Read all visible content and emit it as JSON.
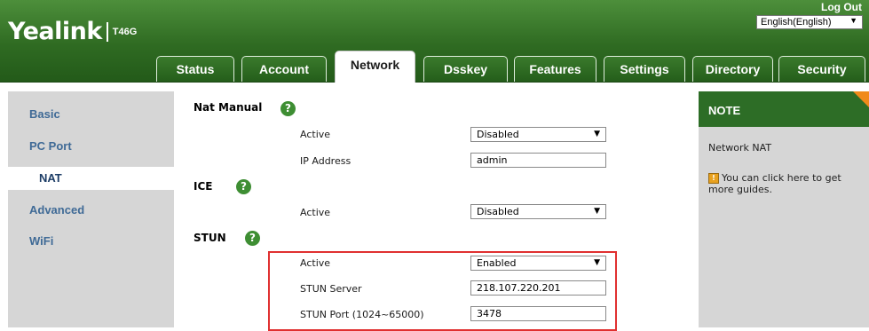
{
  "header": {
    "brand": "Yealink",
    "model": "T46G",
    "logout": "Log Out",
    "language": "English(English)"
  },
  "tabs": [
    {
      "label": "Status"
    },
    {
      "label": "Account"
    },
    {
      "label": "Network",
      "active": true
    },
    {
      "label": "Dsskey"
    },
    {
      "label": "Features"
    },
    {
      "label": "Settings"
    },
    {
      "label": "Directory"
    },
    {
      "label": "Security"
    }
  ],
  "sidebar": {
    "items": [
      {
        "label": "Basic"
      },
      {
        "label": "PC Port"
      },
      {
        "label": "NAT",
        "active": true
      },
      {
        "label": "Advanced"
      },
      {
        "label": "WiFi"
      }
    ]
  },
  "main": {
    "nat_manual": {
      "title": "Nat Manual",
      "active_label": "Active",
      "active_value": "Disabled",
      "ip_label": "IP Address",
      "ip_value": "admin"
    },
    "ice": {
      "title": "ICE",
      "active_label": "Active",
      "active_value": "Disabled"
    },
    "stun": {
      "title": "STUN",
      "active_label": "Active",
      "active_value": "Enabled",
      "server_label": "STUN Server",
      "server_value": "218.107.220.201",
      "port_label": "STUN Port (1024~65000)",
      "port_value": "3478"
    },
    "help_glyph": "?"
  },
  "note": {
    "title": "NOTE",
    "text": "Network NAT",
    "guide": "You can click here to get more guides."
  },
  "colors": {
    "header_green": "#2f6b22",
    "link_blue": "#3f6a96",
    "highlight_red": "#e03030",
    "note_orange": "#f08a1a"
  }
}
